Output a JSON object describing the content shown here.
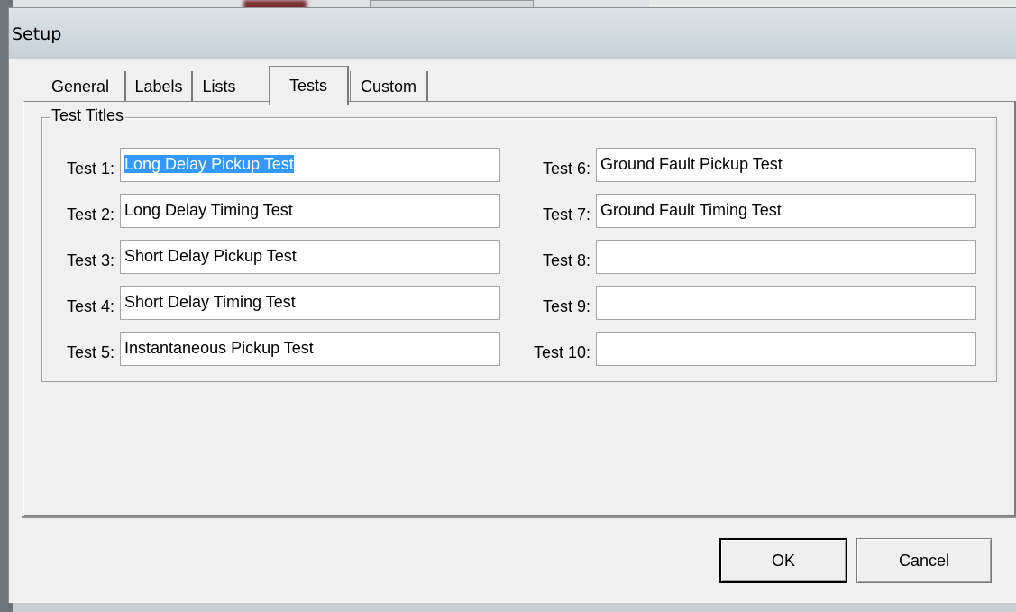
{
  "window": {
    "title": "Setup"
  },
  "tabs": [
    {
      "label": "General"
    },
    {
      "label": "Labels"
    },
    {
      "label": "Lists"
    },
    {
      "label": "Tests",
      "active": true
    },
    {
      "label": "Custom"
    }
  ],
  "group": {
    "caption": "Test Titles"
  },
  "tests_left": [
    {
      "label": "Test 1:",
      "value": "Long Delay Pickup Test",
      "selected": true
    },
    {
      "label": "Test 2:",
      "value": "Long Delay Timing Test"
    },
    {
      "label": "Test 3:",
      "value": "Short Delay Pickup Test"
    },
    {
      "label": "Test 4:",
      "value": "Short Delay Timing Test"
    },
    {
      "label": "Test 5:",
      "value": "Instantaneous Pickup Test"
    }
  ],
  "tests_right": [
    {
      "label": "Test 6:",
      "value": "Ground Fault Pickup Test"
    },
    {
      "label": "Test 7:",
      "value": "Ground Fault Timing Test"
    },
    {
      "label": "Test 8:",
      "value": ""
    },
    {
      "label": "Test 9:",
      "value": ""
    },
    {
      "label": "Test 10:",
      "value": ""
    }
  ],
  "buttons": {
    "ok": "OK",
    "cancel": "Cancel"
  },
  "colors": {
    "selection": "#3399ff",
    "dialog_bg": "#f0f0f0"
  }
}
